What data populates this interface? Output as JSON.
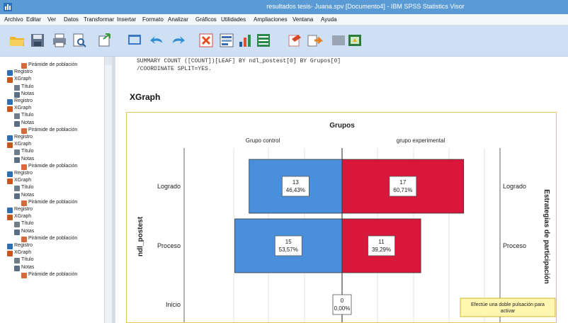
{
  "window": {
    "title": "resultados tesis- Juana.spv [Documento4] - IBM SPSS Statistics Visor"
  },
  "menu": [
    "Archivo",
    "Editar",
    "Ver",
    "Datos",
    "Transformar",
    "Insertar",
    "Formato",
    "Analizar",
    "Gráficos",
    "Utilidades",
    "Ampliaciones",
    "Ventana",
    "Ayuda"
  ],
  "toolbar": {
    "icons": [
      "open-icon",
      "save-icon",
      "print-icon",
      "print-preview-icon",
      "export-icon",
      "recall-dialog-icon",
      "undo-icon",
      "redo-icon",
      "goto-data-icon",
      "goto-case-icon",
      "variables-icon",
      "select-cases-icon",
      "insert-output-icon",
      "show-hide-icon",
      "promote-icon",
      "designate-window-icon"
    ]
  },
  "tree": {
    "items": [
      {
        "label": "Pirámide de población",
        "kind": "pyr",
        "indent": 2
      },
      {
        "label": "Registro",
        "kind": "log",
        "indent": 0
      },
      {
        "label": "XGraph",
        "kind": "xg",
        "indent": 0
      },
      {
        "label": "Título",
        "kind": "title",
        "indent": 1
      },
      {
        "label": "Notas",
        "kind": "notes",
        "indent": 1
      },
      {
        "label": "Registro",
        "kind": "log",
        "indent": 0
      },
      {
        "label": "XGraph",
        "kind": "xg",
        "indent": 0
      },
      {
        "label": "Título",
        "kind": "title",
        "indent": 1
      },
      {
        "label": "Notas",
        "kind": "notes",
        "indent": 1
      },
      {
        "label": "Pirámide de población",
        "kind": "pyr",
        "indent": 2
      },
      {
        "label": "Registro",
        "kind": "log",
        "indent": 0
      },
      {
        "label": "XGraph",
        "kind": "xg",
        "indent": 0
      },
      {
        "label": "Título",
        "kind": "title",
        "indent": 1
      },
      {
        "label": "Notas",
        "kind": "notes",
        "indent": 1
      },
      {
        "label": "Pirámide de población",
        "kind": "pyr",
        "indent": 2
      },
      {
        "label": "Registro",
        "kind": "log",
        "indent": 0
      },
      {
        "label": "XGraph",
        "kind": "xg",
        "indent": 0
      },
      {
        "label": "Título",
        "kind": "title",
        "indent": 1
      },
      {
        "label": "Notas",
        "kind": "notes",
        "indent": 1
      },
      {
        "label": "Pirámide de población",
        "kind": "pyr",
        "indent": 2
      },
      {
        "label": "Registro",
        "kind": "log",
        "indent": 0
      },
      {
        "label": "XGraph",
        "kind": "xg",
        "indent": 0
      },
      {
        "label": "Título",
        "kind": "title",
        "indent": 1
      },
      {
        "label": "Notas",
        "kind": "notes",
        "indent": 1
      },
      {
        "label": "Pirámide de población",
        "kind": "pyr",
        "indent": 2
      },
      {
        "label": "Registro",
        "kind": "log",
        "indent": 0
      },
      {
        "label": "XGraph",
        "kind": "xg",
        "indent": 0
      },
      {
        "label": "Título",
        "kind": "title",
        "indent": 1
      },
      {
        "label": "Notas",
        "kind": "notes",
        "indent": 1
      },
      {
        "label": "Pirámide de población",
        "kind": "pyr",
        "indent": 2
      }
    ]
  },
  "viewer": {
    "syntax_lines": [
      "SUMMARY COUNT ([COUNT])[LEAF] BY ndl_postest[0] BY Grupos[0]",
      "/COORDINATE SPLIT=YES."
    ],
    "heading": "XGraph",
    "tooltip": "Efectúe una doble pulsación para activar"
  },
  "chart_data": {
    "type": "bar",
    "title": "Grupos",
    "panels": [
      "Grupo control",
      "grupo experimental"
    ],
    "ylabel": "ndl_postest",
    "y2label": "Estrategias de participación",
    "categories": [
      "Logrado",
      "Proceso",
      "Inicio"
    ],
    "series": [
      {
        "name": "Grupo control",
        "counts": [
          13,
          15,
          0
        ],
        "labels": [
          "46,43%",
          "53,57%",
          "0,00%"
        ]
      },
      {
        "name": "grupo experimental",
        "counts": [
          17,
          11,
          null
        ],
        "labels": [
          "60,71%",
          "39,29%",
          null
        ]
      }
    ],
    "colors": {
      "control": "#4a8fdc",
      "experimental": "#d9173b"
    }
  }
}
